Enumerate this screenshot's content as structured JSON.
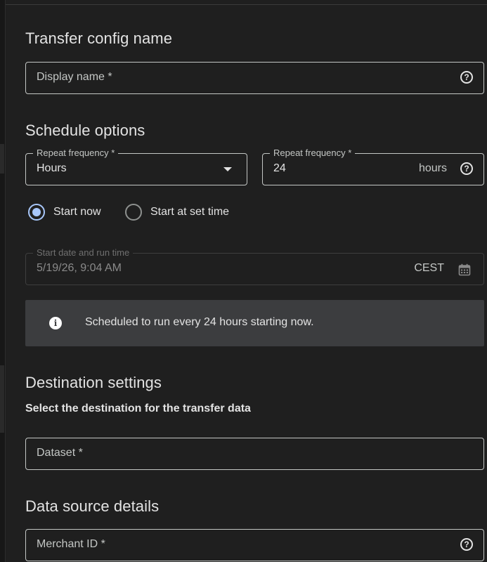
{
  "transfer_config": {
    "heading": "Transfer config name",
    "display_name_placeholder": "Display name *"
  },
  "schedule": {
    "heading": "Schedule options",
    "repeat_frequency_label": "Repeat frequency *",
    "repeat_frequency_value": "Hours",
    "repeat_interval_label": "Repeat frequency *",
    "repeat_interval_value": "24",
    "repeat_interval_suffix": "hours",
    "radio_start_now": "Start now",
    "radio_start_at_set_time": "Start at set time",
    "selected_radio": "Start now",
    "start_date_label": "Start date and run time",
    "start_date_value": "5/19/26, 9:04 AM",
    "timezone": "CEST",
    "info_message": "Scheduled to run every 24 hours starting now."
  },
  "destination": {
    "heading": "Destination settings",
    "subheading": "Select the destination for the transfer data",
    "dataset_placeholder": "Dataset *"
  },
  "data_source": {
    "heading": "Data source details",
    "merchant_id_placeholder": "Merchant ID *"
  },
  "icons": {
    "help": "help-circle-icon",
    "dropdown": "arrow-drop-down-icon",
    "calendar": "calendar-icon",
    "info": "info-icon"
  },
  "colors": {
    "background": "#1f1f1f",
    "text": "#e3e3e3",
    "accent": "#a8c7fa",
    "banner": "#3c3d3f"
  }
}
